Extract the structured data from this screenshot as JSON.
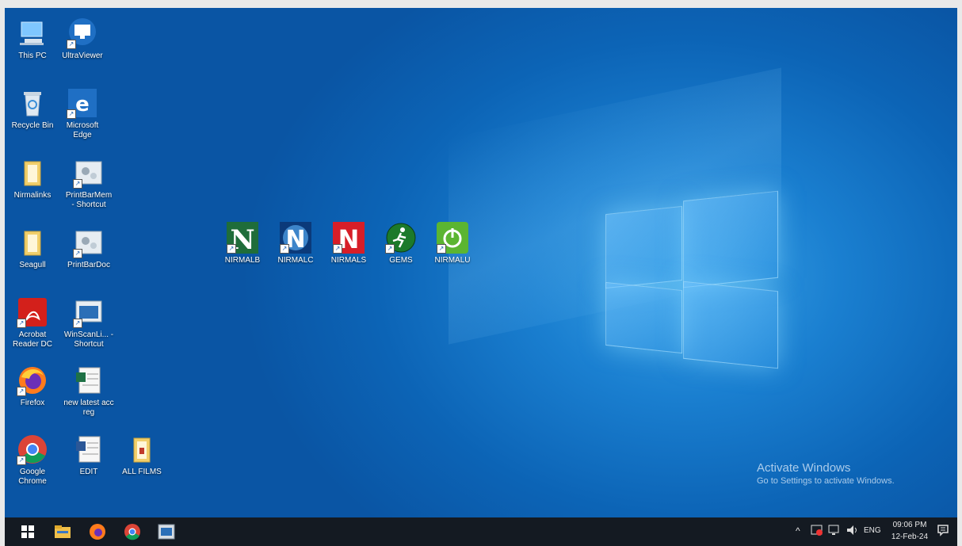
{
  "desktop_icons": [
    {
      "label": "This PC",
      "icon": "computer-icon"
    },
    {
      "label": "UltraViewer",
      "icon": "monitor-icon"
    },
    {
      "label": "Recycle Bin",
      "icon": "recycle-bin-icon"
    },
    {
      "label": "Microsoft Edge",
      "icon": "edge-icon"
    },
    {
      "label": "Nirmalinks",
      "icon": "folder-icon"
    },
    {
      "label": "PrintBarMem - Shortcut",
      "icon": "settings-icon"
    },
    {
      "label": "Seagull",
      "icon": "folder-icon"
    },
    {
      "label": "PrintBarDoc",
      "icon": "settings-icon"
    },
    {
      "label": "Acrobat Reader DC",
      "icon": "acrobat-icon"
    },
    {
      "label": "WinScanLi... - Shortcut",
      "icon": "window-icon"
    },
    {
      "label": "Firefox",
      "icon": "firefox-icon"
    },
    {
      "label": "new latest acc reg",
      "icon": "spreadsheet-icon"
    },
    {
      "label": "Google Chrome",
      "icon": "chrome-icon"
    },
    {
      "label": "EDIT",
      "icon": "document-icon"
    },
    {
      "label": "ALL FILMS",
      "icon": "folder-icon"
    },
    {
      "label": "NIRMALB",
      "icon": "nirmal-n-icon"
    },
    {
      "label": "NIRMALC",
      "icon": "nirmal-n-icon"
    },
    {
      "label": "NIRMALS",
      "icon": "nirmal-n-icon"
    },
    {
      "label": "GEMS",
      "icon": "runner-icon"
    },
    {
      "label": "NIRMALU",
      "icon": "power-icon"
    }
  ],
  "watermark": {
    "title": "Activate Windows",
    "subtitle": "Go to Settings to activate Windows."
  },
  "taskbar": {
    "pinned": [
      "start-icon",
      "file-explorer-icon",
      "firefox-icon",
      "chrome-icon",
      "app-window-icon"
    ],
    "tray": {
      "language": "ENG",
      "time": "09:06 PM",
      "date": "12-Feb-24"
    }
  },
  "colors": {
    "desktop_blue": "#0c64b6",
    "taskbar": "#141a22"
  }
}
